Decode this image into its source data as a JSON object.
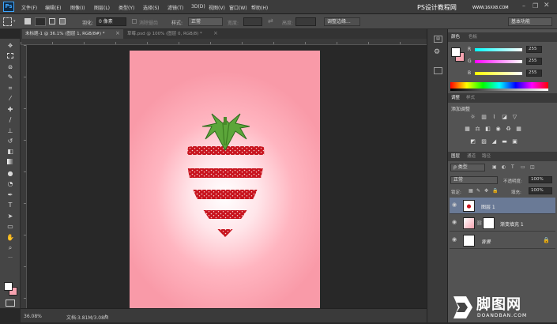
{
  "menubar": {
    "logo": "Ps",
    "items": [
      "文件(F)",
      "编辑(E)",
      "图像(I)",
      "图层(L)",
      "类型(Y)",
      "选择(S)",
      "滤镜(T)",
      "3D(D)",
      "视图(V)",
      "窗口(W)",
      "帮助(H)"
    ],
    "watermark": "PS设计教程网",
    "watermark_url": "WWW.16XX8.COM"
  },
  "options": {
    "feather_label": "羽化:",
    "feather_value": "0 像素",
    "antialias": "消除锯齿",
    "style_label": "样式:",
    "style_value": "正常",
    "width_label": "宽度:",
    "height_label": "高度:",
    "refine_button": "调整边缘...",
    "workspace": "基本功能"
  },
  "tabs": [
    {
      "label": "未标题-1 @ 36.1% (图层 1, RGB/8#) *",
      "close": "×"
    },
    {
      "label": "草莓.psd @ 100% (图层 0, RGB/8) *",
      "close": "×"
    }
  ],
  "statusbar": {
    "zoom": "36.08%",
    "doc": "文档:3.81M/3.08M"
  },
  "color_panel": {
    "tabs": [
      "颜色",
      "色板"
    ],
    "channels": [
      {
        "label": "R",
        "value": "255"
      },
      {
        "label": "G",
        "value": "255"
      },
      {
        "label": "B",
        "value": "255"
      }
    ]
  },
  "adjust_panel": {
    "tabs": [
      "调整",
      "样式"
    ],
    "title": "添加调整"
  },
  "layers_panel": {
    "tabs": [
      "图层",
      "通道",
      "路径"
    ],
    "filter": "ρ 类型",
    "blend": "正常",
    "opacity_label": "不透明度:",
    "opacity": "100%",
    "lock_label": "锁定:",
    "fill_label": "填充:",
    "fill": "100%",
    "layers": [
      {
        "name": "图层 1",
        "selected": true
      },
      {
        "name": "渐变填充 1",
        "selected": false
      },
      {
        "name": "背景",
        "selected": false
      }
    ]
  },
  "footer_watermark": {
    "main": "脚图网",
    "url": "DOANDBAN.COM"
  }
}
